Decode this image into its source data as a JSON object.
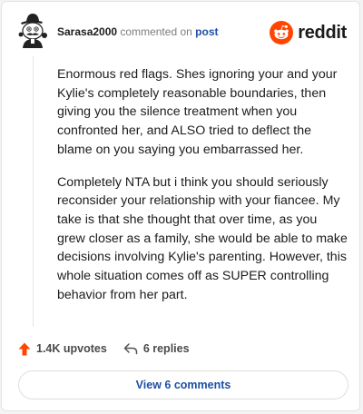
{
  "comment": {
    "username": "Sarasa2000",
    "verb": "commented on",
    "post_link": "post",
    "paragraphs": [
      "Enormous red flags. Shes ignoring your and your Kylie's completely reasonable boundaries, then giving you the silence treatment when you confronted her, and ALSO tried to deflect the blame on you saying you embarrassed her.",
      "Completely NTA but i think you should seriously reconsider your relationship with your fiancee. My take is that she thought that over time, as you grew closer as a family, she would be able to make decisions involving Kylie's parenting. However, this whole situation comes off as SUPER controlling behavior from her part."
    ]
  },
  "brand": {
    "name": "reddit",
    "icon": "reddit-logo-icon",
    "color": "#ff4500"
  },
  "actions": {
    "upvotes": "1.4K upvotes",
    "replies": "6 replies",
    "upvote_icon": "upvote-arrow-icon",
    "reply_icon": "reply-arrow-icon",
    "upvote_color": "#ff4500"
  },
  "view_comments": "View 6 comments",
  "colors": {
    "link": "#1e4fa3",
    "text": "#1c1c1c",
    "muted": "#7c7c7c"
  }
}
